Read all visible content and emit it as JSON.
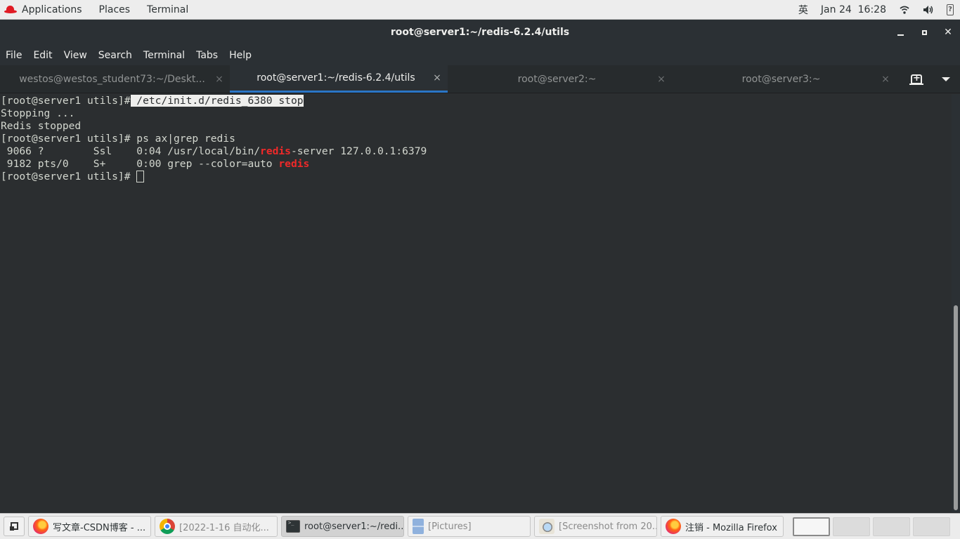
{
  "topbar": {
    "menus": [
      "Applications",
      "Places",
      "Terminal"
    ],
    "input_method": "英",
    "datetime": "Jan 24  16:28",
    "icons": [
      "redhat-logo-icon",
      "wifi-icon",
      "volume-icon",
      "battery-unknown-icon"
    ],
    "battery_glyph": "?"
  },
  "window": {
    "title": "root@server1:~/redis-6.2.4/utils",
    "close_glyph": "✕"
  },
  "menubar": {
    "items": [
      "File",
      "Edit",
      "View",
      "Search",
      "Terminal",
      "Tabs",
      "Help"
    ]
  },
  "tabs": [
    {
      "label": "westos@westos_student73:~/Deskt...",
      "active": false
    },
    {
      "label": "root@server1:~/redis-6.2.4/utils",
      "active": true
    },
    {
      "label": "root@server2:~",
      "active": false
    },
    {
      "label": "root@server3:~",
      "active": false
    }
  ],
  "tab_close_glyph": "×",
  "terminal": {
    "prompt": "[root@server1 utils]#",
    "lines": [
      {
        "prompt": "[root@server1 utils]#",
        "command": " /etc/init.d/redis_6380 stop"
      },
      {
        "text": "Stopping ..."
      },
      {
        "text": "Redis stopped"
      },
      {
        "prompt": "[root@server1 utils]#",
        "command": " ps ax|grep redis"
      },
      {
        "pre": " 9066 ?        Ssl    0:04 /usr/local/bin/",
        "match": "redis",
        "post": "-server 127.0.0.1:6379"
      },
      {
        "pre": " 9182 pts/0    S+     0:00 grep --color=auto ",
        "match": "redis",
        "post": ""
      },
      {
        "prompt": "[root@server1 utils]#",
        "command": " "
      }
    ]
  },
  "scrollbar": {
    "position_fraction": 0.5,
    "visible_fraction": 0.5
  },
  "taskbar": {
    "tasks": [
      {
        "label": "写文章-CSDN博客 - ...",
        "icon": "firefox-icon",
        "state": "normal"
      },
      {
        "label": "[2022-1-16 自动化...",
        "icon": "chrome-icon",
        "state": "minimized"
      },
      {
        "label": "root@server1:~/redi...",
        "icon": "terminal-icon",
        "state": "active"
      },
      {
        "label": "[Pictures]",
        "icon": "files-icon",
        "state": "minimized"
      },
      {
        "label": "[Screenshot from 20...",
        "icon": "image-viewer-icon",
        "state": "minimized"
      },
      {
        "label": "注销 - Mozilla Firefox",
        "icon": "firefox-icon",
        "state": "normal"
      }
    ],
    "workspaces": 4,
    "current_workspace": 1
  }
}
